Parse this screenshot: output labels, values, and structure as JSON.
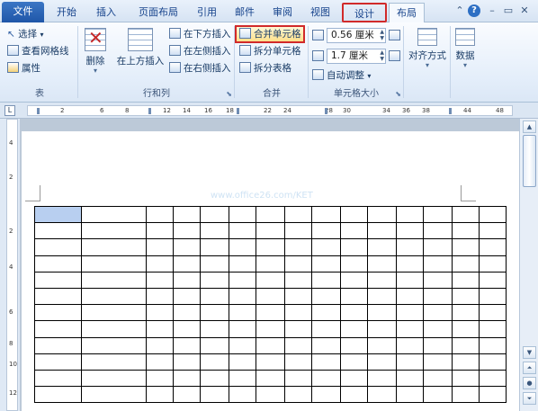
{
  "tabs": [
    "文件",
    "开始",
    "插入",
    "页面布局",
    "引用",
    "邮件",
    "审阅",
    "视图",
    "设计",
    "布局"
  ],
  "window_controls": {
    "help": "?",
    "minimize": "–",
    "restore": "▭",
    "close": "✕"
  },
  "groups": {
    "table": {
      "label": "表",
      "select": "选择",
      "gridlines": "查看网格线",
      "properties": "属性"
    },
    "rows_cols": {
      "label": "行和列",
      "delete": "删除",
      "insert_above": "在上方插入",
      "insert_below": "在下方插入",
      "insert_left": "在左侧插入",
      "insert_right": "在右侧插入"
    },
    "merge": {
      "label": "合并",
      "merge_cells": "合并单元格",
      "split_cells": "拆分单元格",
      "split_table": "拆分表格"
    },
    "cell_size": {
      "label": "单元格大小",
      "height": "0.56 厘米",
      "width": "1.7 厘米",
      "autofit": "自动调整"
    },
    "alignment": {
      "label": "对齐方式"
    },
    "data": {
      "label": "数据"
    }
  },
  "ruler_numbers": [
    "2",
    "6",
    "8",
    "12",
    "14",
    "16",
    "18",
    "22",
    "24",
    "28",
    "30",
    "34",
    "36",
    "38",
    "44",
    "48"
  ],
  "vruler_numbers": [
    "4",
    "2",
    "2",
    "4",
    "6",
    "8",
    "10",
    "12"
  ],
  "table": {
    "rows": 12,
    "cols": 15,
    "selected_cell": [
      0,
      0
    ]
  },
  "watermark": "www.office26.com/KET",
  "colors": {
    "file_tab": "#2a63b5",
    "highlight_box": "#d12a2a",
    "merge_button": "#ffe08a",
    "selected_cell": "#b8cff0"
  },
  "icons": [
    "select-icon",
    "gridlines-icon",
    "properties-icon",
    "delete-icon",
    "insert-above-icon",
    "insert-below-icon",
    "insert-left-icon",
    "insert-right-icon",
    "merge-cells-icon",
    "split-cells-icon",
    "split-table-icon",
    "row-height-icon",
    "col-width-icon",
    "autofit-icon",
    "distribute-rows-icon",
    "distribute-cols-icon",
    "alignment-icon",
    "data-icon"
  ]
}
